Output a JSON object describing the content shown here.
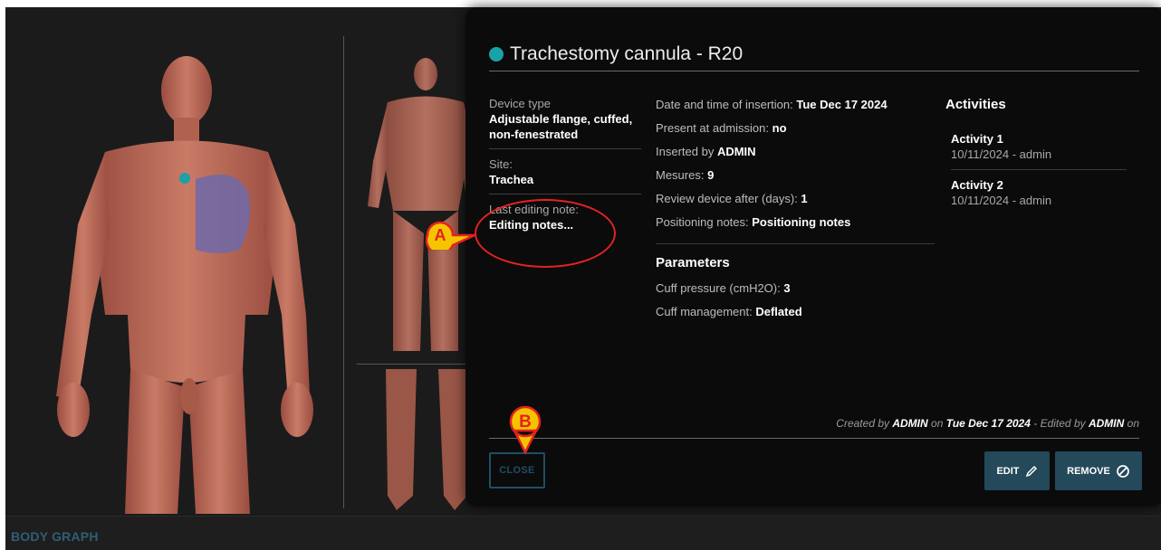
{
  "footer": {
    "label": "BODY GRAPH"
  },
  "panel": {
    "title": "Trachestomy cannula - R20",
    "status_color": "#1aa2a6",
    "device_type_label": "Device type",
    "device_type_value": "Adjustable flange, cuffed, non-fenestrated",
    "site_label": "Site:",
    "site_value": "Trachea",
    "note_label": "Last editing note:",
    "note_value": "Editing notes...",
    "insertion_label": "Date and time of insertion:",
    "insertion_value": "Tue Dec 17 2024",
    "admission_label": "Present at admission:",
    "admission_value": "no",
    "inserted_label": "Inserted by",
    "inserted_value": "ADMIN",
    "mesures_label": "Mesures:",
    "mesures_value": "9",
    "review_label": "Review device after (days):",
    "review_value": "1",
    "positioning_label": "Positioning notes:",
    "positioning_value": "Positioning notes",
    "parameters_title": "Parameters",
    "cuff_pressure_label": "Cuff pressure (cmH2O):",
    "cuff_pressure_value": "3",
    "cuff_mgmt_label": "Cuff management:",
    "cuff_mgmt_value": "Deflated",
    "activities_title": "Activities",
    "activities": [
      {
        "name": "Activity 1",
        "sub": "10/11/2024 - admin"
      },
      {
        "name": "Activity 2",
        "sub": "10/11/2024 - admin"
      }
    ],
    "footer_created_by_prefix": "Created by",
    "footer_created_by": "ADMIN",
    "footer_on": "on",
    "footer_created_date": "Tue Dec 17 2024",
    "footer_edited_prefix": "- Edited by",
    "footer_edited_by": "ADMIN",
    "footer_edited_on": "on",
    "close_label": "CLOSE",
    "edit_label": "EDIT",
    "remove_label": "REMOVE"
  },
  "annotations": {
    "a": "A",
    "b": "B",
    "color": "#e32222",
    "fill": "#f5c400"
  },
  "icons": {
    "edit": "pencil-icon",
    "remove": "cancel-circle-icon"
  }
}
